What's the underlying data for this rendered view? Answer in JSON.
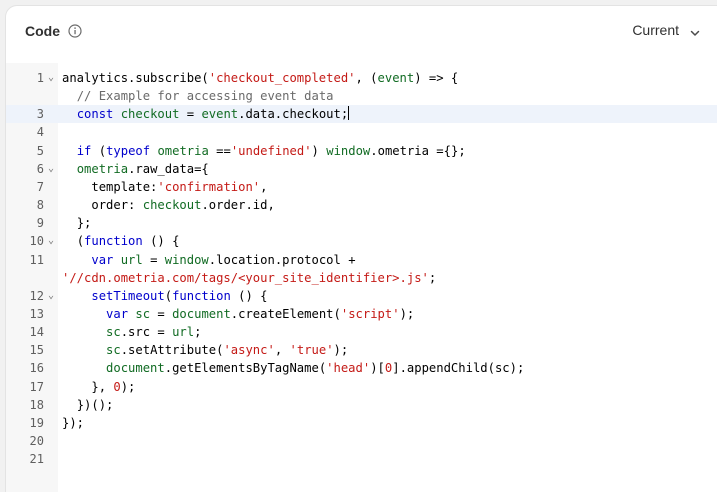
{
  "header": {
    "title": "Code",
    "version_label": "Current"
  },
  "icons": {
    "info": "info-icon",
    "chevron": "chevron-down-icon"
  },
  "editor": {
    "active_line": 3,
    "lines": [
      {
        "n": "1",
        "fold": true,
        "indent": 0,
        "tokens": [
          [
            "",
            "analytics.subscribe("
          ],
          [
            "str",
            "'checkout_completed'"
          ],
          [
            "",
            ", ("
          ],
          [
            "var",
            "event"
          ],
          [
            "",
            ") => {"
          ]
        ]
      },
      {
        "n": "",
        "fold": false,
        "indent": 2,
        "tokens": [
          [
            "cmt",
            "// Example for accessing event data"
          ]
        ]
      },
      {
        "n": "3",
        "fold": false,
        "indent": 2,
        "cursor": true,
        "tokens": [
          [
            "kw",
            "const "
          ],
          [
            "var",
            "checkout"
          ],
          [
            "",
            " = "
          ],
          [
            "var",
            "event"
          ],
          [
            "",
            ".data.checkout;"
          ]
        ]
      },
      {
        "n": "4",
        "fold": false,
        "indent": 0,
        "tokens": []
      },
      {
        "n": "5",
        "fold": false,
        "indent": 2,
        "tokens": [
          [
            "kw",
            "if"
          ],
          [
            "",
            " ("
          ],
          [
            "kw",
            "typeof "
          ],
          [
            "var",
            "ometria"
          ],
          [
            "",
            " =="
          ],
          [
            "str",
            "'undefined'"
          ],
          [
            "",
            ") "
          ],
          [
            "var",
            "window"
          ],
          [
            "",
            ".ometria ={};"
          ]
        ]
      },
      {
        "n": "6",
        "fold": true,
        "indent": 2,
        "tokens": [
          [
            "var",
            "ometria"
          ],
          [
            "",
            ".raw_data={"
          ]
        ]
      },
      {
        "n": "7",
        "fold": false,
        "indent": 4,
        "tokens": [
          [
            "",
            "template:"
          ],
          [
            "str",
            "'confirmation'"
          ],
          [
            "",
            ","
          ]
        ]
      },
      {
        "n": "8",
        "fold": false,
        "indent": 4,
        "tokens": [
          [
            "",
            "order: "
          ],
          [
            "var",
            "checkout"
          ],
          [
            "",
            ".order.id,"
          ]
        ]
      },
      {
        "n": "9",
        "fold": false,
        "indent": 2,
        "tokens": [
          [
            "",
            "};"
          ]
        ]
      },
      {
        "n": "10",
        "fold": true,
        "indent": 2,
        "tokens": [
          [
            "",
            "("
          ],
          [
            "kw",
            "function"
          ],
          [
            "",
            " () {"
          ]
        ]
      },
      {
        "n": "11",
        "fold": false,
        "indent": 4,
        "tokens": [
          [
            "kw",
            "var "
          ],
          [
            "var",
            "url"
          ],
          [
            "",
            " = "
          ],
          [
            "var",
            "window"
          ],
          [
            "",
            ".location.protocol +"
          ]
        ]
      },
      {
        "n": "",
        "fold": false,
        "indent": 0,
        "tokens": [
          [
            "str",
            "'//cdn.ometria.com/tags/<your_site_identifier>.js'"
          ],
          [
            "",
            ";"
          ]
        ]
      },
      {
        "n": "12",
        "fold": true,
        "indent": 4,
        "tokens": [
          [
            "fn",
            "setTimeout"
          ],
          [
            "",
            "("
          ],
          [
            "kw",
            "function"
          ],
          [
            "",
            " () {"
          ]
        ]
      },
      {
        "n": "13",
        "fold": false,
        "indent": 6,
        "tokens": [
          [
            "kw",
            "var "
          ],
          [
            "var",
            "sc"
          ],
          [
            "",
            " = "
          ],
          [
            "var",
            "document"
          ],
          [
            "",
            ".createElement("
          ],
          [
            "str",
            "'script'"
          ],
          [
            "",
            ");"
          ]
        ]
      },
      {
        "n": "14",
        "fold": false,
        "indent": 6,
        "tokens": [
          [
            "var",
            "sc"
          ],
          [
            "",
            ".src = "
          ],
          [
            "var",
            "url"
          ],
          [
            "",
            ";"
          ]
        ]
      },
      {
        "n": "15",
        "fold": false,
        "indent": 6,
        "tokens": [
          [
            "var",
            "sc"
          ],
          [
            "",
            ".setAttribute("
          ],
          [
            "str",
            "'async'"
          ],
          [
            "",
            ", "
          ],
          [
            "str",
            "'true'"
          ],
          [
            "",
            ");"
          ]
        ]
      },
      {
        "n": "16",
        "fold": false,
        "indent": 6,
        "tokens": [
          [
            "var",
            "document"
          ],
          [
            "",
            ".getElementsByTagName("
          ],
          [
            "str",
            "'head'"
          ],
          [
            "",
            ")["
          ],
          [
            "str",
            "0"
          ],
          [
            "",
            "].appendChild(sc);"
          ]
        ]
      },
      {
        "n": "17",
        "fold": false,
        "indent": 4,
        "tokens": [
          [
            "",
            "}, "
          ],
          [
            "str",
            "0"
          ],
          [
            "",
            ");"
          ]
        ]
      },
      {
        "n": "18",
        "fold": false,
        "indent": 2,
        "tokens": [
          [
            "",
            "})();"
          ]
        ]
      },
      {
        "n": "19",
        "fold": false,
        "indent": 0,
        "tokens": [
          [
            "",
            "});"
          ]
        ]
      },
      {
        "n": "20",
        "fold": false,
        "indent": 0,
        "tokens": []
      },
      {
        "n": "21",
        "fold": false,
        "indent": 0,
        "tokens": []
      }
    ]
  }
}
